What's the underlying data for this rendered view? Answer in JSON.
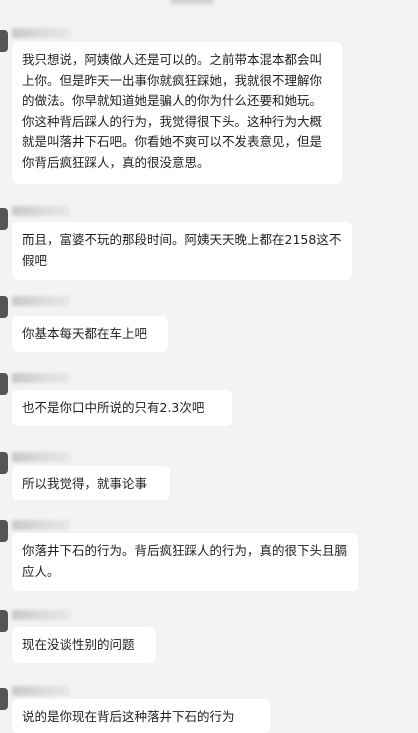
{
  "messages": [
    {
      "text": "我只想说，阿姨做人还是可以的。之前带本混本都会叫上你。但是昨天一出事你就疯狂踩她，我就很不理解你的做法。你早就知道她是骗人的你为什么还要和她玩。你这种背后踩人的行为，我觉得很下头。这种行为大概就是叫落井下石吧。你看她不爽可以不发表意见，但是你背后疯狂踩人，真的很没意思。"
    },
    {
      "text": "而且，富婆不玩的那段时间。阿姨天天晚上都在2158这不假吧"
    },
    {
      "text": "你基本每天都在车上吧"
    },
    {
      "text": "也不是你口中所说的只有2.3次吧"
    },
    {
      "text": "所以我觉得，就事论事"
    },
    {
      "text": "你落井下石的行为。背后疯狂踩人的行为，真的很下头且膈应人。"
    },
    {
      "text": "现在没谈性别的问题"
    },
    {
      "text": "说的是你现在背后这种落井下石的行为"
    }
  ]
}
